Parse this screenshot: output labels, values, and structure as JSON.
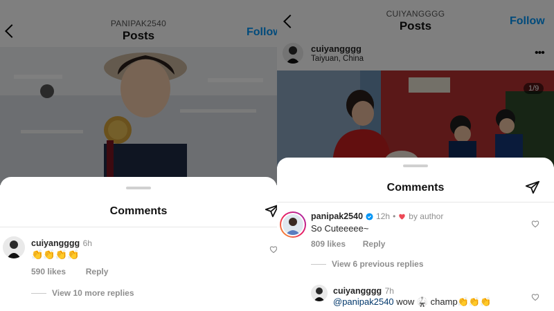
{
  "left": {
    "header": {
      "username": "PANIPAK2540",
      "title": "Posts",
      "follow_label": "Follow"
    },
    "sheet": {
      "title": "Comments"
    },
    "comment": {
      "username": "cuiyangggg",
      "time": "6h",
      "text": "👏👏👏👏",
      "likes": "590 likes",
      "reply_label": "Reply",
      "view_replies": "View 10 more replies"
    }
  },
  "right": {
    "header": {
      "username": "CUIYANGGGG",
      "title": "Posts",
      "follow_label": "Follow"
    },
    "post": {
      "username": "cuiyangggg",
      "location": "Taiyuan, China",
      "counter": "1/9",
      "more_icon": "more-horizontal-icon"
    },
    "sheet": {
      "title": "Comments"
    },
    "comment": {
      "username": "panipak2540",
      "time": "12h",
      "by_author": "by author",
      "text": "So Cuteeeee~",
      "likes": "809 likes",
      "reply_label": "Reply",
      "view_replies": "View 6 previous replies"
    },
    "reply": {
      "username": "cuiyangggg",
      "time": "7h",
      "mention": "@panipak2540",
      "text": " wow 🥋 champ👏👏👏"
    }
  },
  "colors": {
    "accent": "#0095f6",
    "heart": "#ed4956",
    "verified": "#0095f6"
  }
}
